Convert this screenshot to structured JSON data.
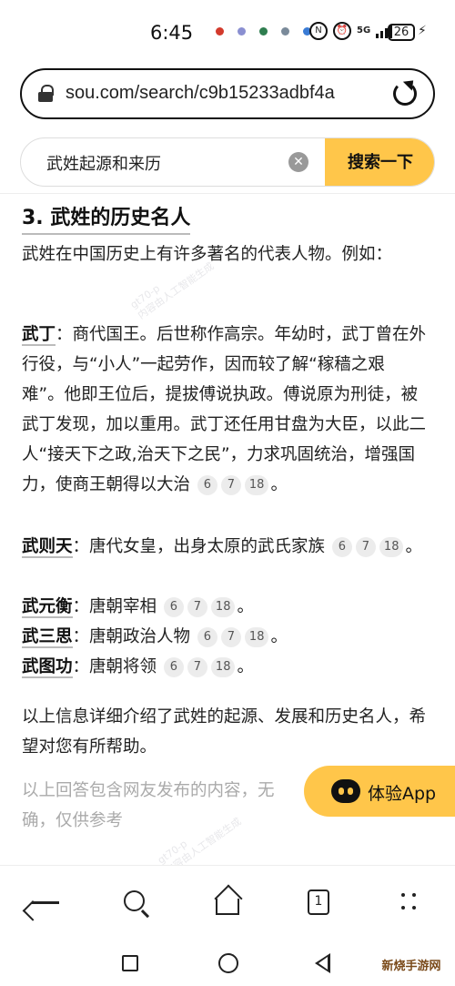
{
  "status_bar": {
    "time": "6:45",
    "network": "5G",
    "battery": "26",
    "notif_colors": [
      "#d33a2c",
      "#8a8fd1",
      "#2e7d4f",
      "#7a8a9a",
      "#3a7bd5"
    ]
  },
  "url_bar": {
    "url": "sou.com/search/c9b15233adbf4a",
    "lock_icon": "lock-icon",
    "reload_icon": "reload-icon"
  },
  "search": {
    "query": "武姓起源和来历",
    "clear_symbol": "✕",
    "button_label": "搜索一下"
  },
  "article": {
    "heading": "3. 武姓的历史名人",
    "intro": "武姓在中国历史上有许多著名的代表人物。例如：",
    "people": [
      {
        "name": "武丁",
        "desc": "：商代国王。后世称作高宗。年幼时，武丁曾在外行役，与“小人”一起劳作，因而较了解“稼穑之艰难”。他即王位后，提拔傅说执政。傅说原为刑徒，被武丁发现，加以重用。武丁还任用甘盘为大臣，以此二人“接天下之政,治天下之民”，力求巩固统治，增强国力，使商王朝得以大治",
        "cites": [
          "6",
          "7",
          "18"
        ]
      },
      {
        "name": "武则天",
        "desc": "：唐代女皇，出身太原的武氏家族",
        "cites": [
          "6",
          "7",
          "18"
        ]
      },
      {
        "name": "武元衡",
        "desc": "：唐朝宰相",
        "cites": [
          "6",
          "7",
          "18"
        ]
      },
      {
        "name": "武三思",
        "desc": "：唐朝政治人物",
        "cites": [
          "6",
          "7",
          "18"
        ]
      },
      {
        "name": "武图功",
        "desc": "：唐朝将领",
        "cites": [
          "6",
          "7",
          "18"
        ]
      }
    ],
    "end_mark": "。",
    "summary": "以上信息详细介绍了武姓的起源、发展和历史名人，希望对您有所帮助。",
    "disclaimer_1": "以上回答包含网友发布的内容，无",
    "disclaimer_2": "确，仅供参考"
  },
  "floating_app": {
    "label": "体验App"
  },
  "bottom_nav": {
    "tab_count": "1"
  },
  "corner_logo": "新烧手游网"
}
